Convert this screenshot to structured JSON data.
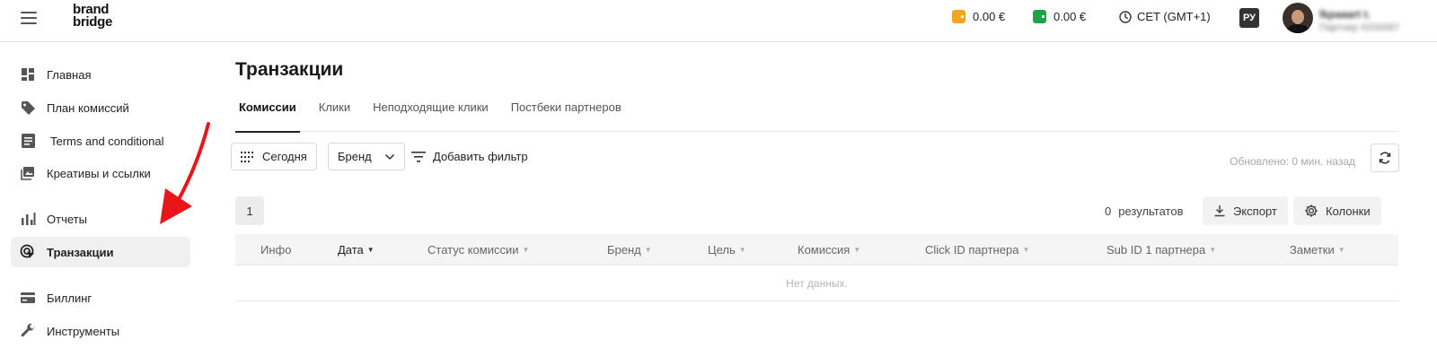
{
  "header": {
    "logo_line1": "brand",
    "logo_line2": "bridge",
    "wallet1": {
      "amount": "0.00 €",
      "color": "#f0a623",
      "icon": "wallet-icon"
    },
    "wallet2": {
      "amount": "0.00 €",
      "color": "#1fa34a",
      "icon": "wallet-icon"
    },
    "timezone": "CET (GMT+1)",
    "language": "РУ",
    "user_name": "lkpaaart t.",
    "user_sub": "Партнер #200087"
  },
  "sidebar": {
    "items": [
      {
        "label": "Главная",
        "icon": "dashboard-icon"
      },
      {
        "label": "План комиссий",
        "icon": "tag-icon"
      },
      {
        "label": "Terms and conditional",
        "icon": "document-icon"
      },
      {
        "label": "Креативы и ссылки",
        "icon": "image-icon"
      },
      {
        "label": "Отчеты",
        "icon": "bar-chart-icon"
      },
      {
        "label": "Транзакции",
        "icon": "transactions-icon",
        "active": true
      },
      {
        "label": "Биллинг",
        "icon": "credit-card-icon"
      },
      {
        "label": "Инструменты",
        "icon": "wrench-icon"
      }
    ]
  },
  "annotation": {
    "color": "#e8161b",
    "icon": "red-arrow-icon"
  },
  "main": {
    "title": "Транзакции",
    "tabs": [
      "Комиссии",
      "Клики",
      "Неподходящие клики",
      "Постбеки партнеров"
    ],
    "active_tab": 0,
    "filters": {
      "date_label": "Сегодня",
      "brand_label": "Бренд",
      "add_filter_label": "Добавить фильтр",
      "updated_text": "Обновлено: 0 мин. назад"
    },
    "pagination": {
      "page": "1"
    },
    "results": {
      "count": "0",
      "label": "результатов"
    },
    "export_label": "Экспорт",
    "columns_label": "Колонки",
    "table": {
      "headers": [
        "Инфо",
        "Дата",
        "Статус комиссии",
        "Бренд",
        "Цель",
        "Комиссия",
        "Click ID партнера",
        "Sub ID 1 партнера",
        "Заметки"
      ],
      "sorted_column": "Дата",
      "empty_text": "Нет данных."
    }
  }
}
